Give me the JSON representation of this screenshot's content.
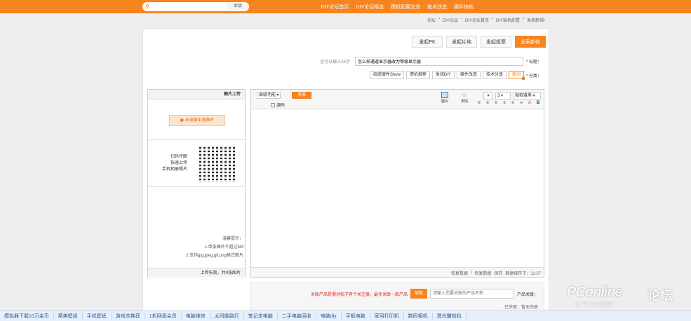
{
  "topnav": [
    "DIY论坛首页",
    "DIY论坛精选",
    "攒机配置交流",
    "技术改造",
    "硬件热帖"
  ],
  "search": {
    "placeholder": "",
    "scope": "本版"
  },
  "breadcrumb": [
    "论坛",
    "DIY论坛",
    "DIY论坛首页",
    "DIY装机配置",
    "发表新帖"
  ],
  "tabs": [
    "发表新帖",
    "发起投票",
    "发起片地",
    "发起PK"
  ],
  "title_row": {
    "label": "* 标题：",
    "value": "怎么样通道显示器改为等级显示器",
    "hint": "还可以输入35字"
  },
  "category_row": {
    "label": "* 分类：",
    "items": [
      "原创",
      "技术分享",
      "硬件改造",
      "发烧DIY",
      "攒机推荐",
      "招揽硬件Show"
    ]
  },
  "editor": {
    "font": "微软雅黑",
    "size": "3",
    "fmt": "▾",
    "format_buttons": [
      "B",
      "A",
      "∞",
      "≡",
      "≡",
      "≡",
      "≡",
      "≡"
    ],
    "emoji_label": "表情",
    "image_label": "图片",
    "publish": "发表",
    "advanced": "高级功能",
    "source_label": "源码",
    "status": [
      "数据保存于：11:37",
      "保存",
      "恢复数据",
      "|",
      "恢复数据"
    ]
  },
  "upload": {
    "header": "图片上传",
    "upload_button": "从电脑中选图片",
    "qr_text": [
      "扫码传图",
      "快速上传",
      "手机相册照片"
    ],
    "tips_title": "温馨提示：",
    "tips": [
      "1.单张图片不超过5M",
      "2.支持jpg,jpeg,gif,png格式图片"
    ],
    "footer": "上传失败，共0张图片"
  },
  "product": {
    "label": "产品关联：",
    "placeholder": "请输入您要关联的产品名称",
    "button": "搜索",
    "warning": "关联产品是需对帖子有个关注度，最多关联一款产品",
    "keyword": "已关联：暂无关联"
  },
  "watermark": {
    "main": "PConline",
    "sub": "太平洋电脑网",
    "cn": "论坛"
  },
  "bottombar": [
    "激光雕刻机",
    "数码相机",
    "家用打印机",
    "平板电脑",
    "电脑diy",
    "二手电脑回收",
    "笔记本电脑",
    "太阳能路灯",
    "电脑维修",
    "1折网盘会员",
    "游戏本推荐",
    "手机壁纸",
    "精美壁纸",
    "模拟器下载10万金币"
  ]
}
